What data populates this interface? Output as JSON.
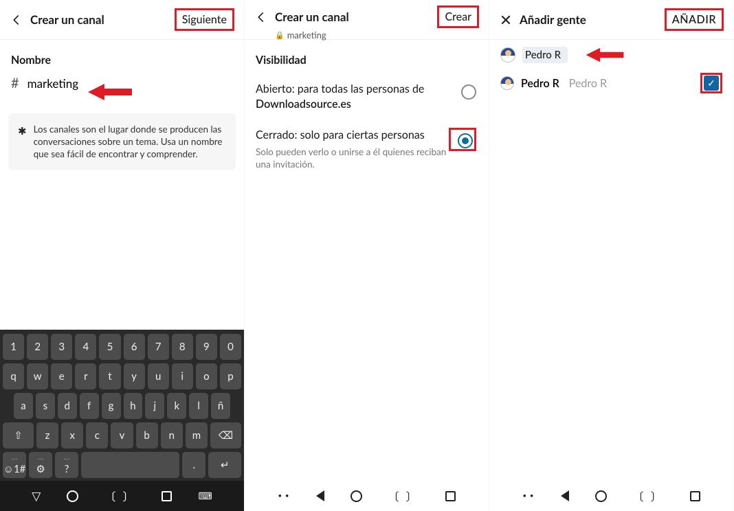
{
  "panel1": {
    "header": {
      "title": "Crear un canal",
      "action": "Siguiente"
    },
    "section": "Nombre",
    "channel_value": "marketing",
    "tip": "Los canales son el lugar donde se producen las conversaciones sobre un tema. Usa un nombre que sea fácil de encontrar y comprender.",
    "keyboard": {
      "nums": [
        "1",
        "2",
        "3",
        "4",
        "5",
        "6",
        "7",
        "8",
        "9",
        "0"
      ],
      "row1": [
        "q",
        "w",
        "e",
        "r",
        "t",
        "y",
        "u",
        "i",
        "o",
        "p"
      ],
      "row2": [
        "a",
        "s",
        "d",
        "f",
        "g",
        "h",
        "j",
        "k",
        "l",
        "ñ"
      ],
      "row3": [
        "⇧",
        "z",
        "x",
        "c",
        "v",
        "b",
        "n",
        "m",
        "⌫"
      ],
      "row4": [
        "☺1#",
        "⚙",
        "?",
        " ",
        ".",
        "↵"
      ]
    }
  },
  "panel2": {
    "header": {
      "title": "Crear un canal",
      "action": "Crear",
      "sub": "marketing"
    },
    "section": "Visibilidad",
    "opt_open": {
      "line1": "Abierto: para todas las personas de",
      "line2": "Downloadsource.es"
    },
    "opt_closed": {
      "line1": "Cerrado: solo para ciertas personas",
      "sub": "Solo pueden verlo o unirse a él quienes reciban una invitación."
    }
  },
  "panel3": {
    "header": {
      "title": "Añadir gente",
      "action": "AÑADIR"
    },
    "chip": "Pedro R",
    "person": {
      "name": "Pedro R",
      "handle": "Pedro R"
    }
  }
}
